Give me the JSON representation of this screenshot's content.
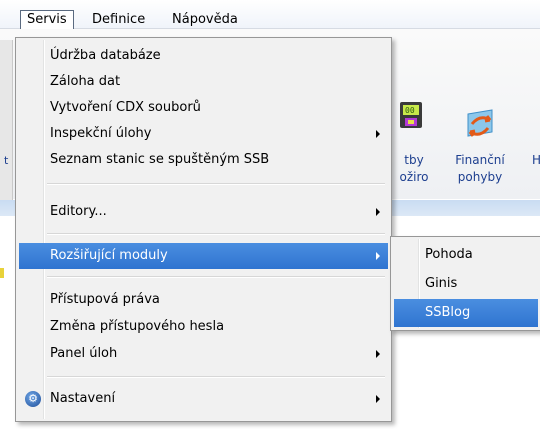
{
  "menubar": {
    "items": [
      "Servis",
      "Definice",
      "Nápověda"
    ]
  },
  "toolbar": {
    "button_1_label_line1": "tby",
    "button_1_label_line2": "ožiro",
    "button_2_label_line1": "Finanční",
    "button_2_label_line2": "pohyby",
    "button_3_label_partial": "H",
    "left_partial": "t"
  },
  "menu": {
    "items": [
      {
        "label": "Údržba databáze"
      },
      {
        "label": "Záloha dat"
      },
      {
        "label": "Vytvoření CDX souborů"
      },
      {
        "label": "Inspekční úlohy"
      },
      {
        "label": "Seznam stanic se spuštěným SSB"
      },
      {
        "label": "Editory..."
      },
      {
        "label": "Rozšiřující moduly"
      },
      {
        "label": "Přístupová práva"
      },
      {
        "label": "Změna přístupového hesla"
      },
      {
        "label": "Panel úloh"
      },
      {
        "label": "Nastavení"
      }
    ]
  },
  "submenu": {
    "items": [
      {
        "label": "Pohoda"
      },
      {
        "label": "Ginis"
      },
      {
        "label": "SSBlog"
      }
    ]
  },
  "icons": {
    "settings_icon": "gear-icon",
    "finance_icon": "finance-arrows-icon",
    "payment_icon": "payment-icon"
  },
  "colors": {
    "highlight": "#3a80d8",
    "menu_bg": "#f1f1f1",
    "toolbar_text": "#1d3f8f"
  }
}
